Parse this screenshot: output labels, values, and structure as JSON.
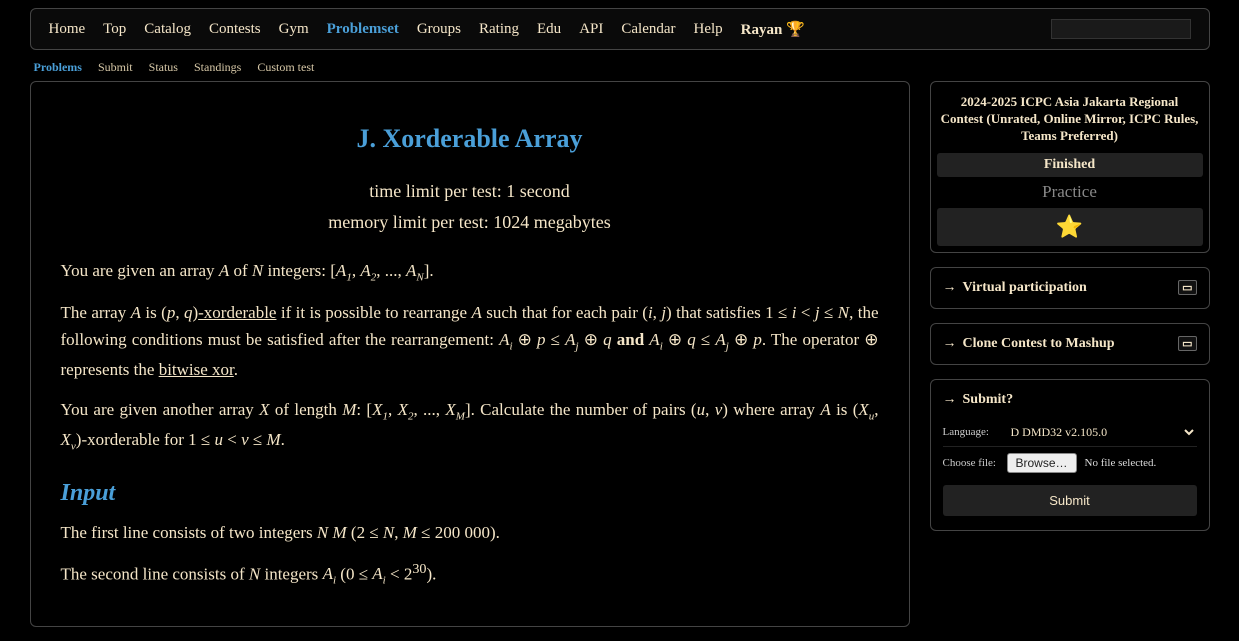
{
  "nav": {
    "items": [
      {
        "label": "Home",
        "active": false
      },
      {
        "label": "Top",
        "active": false
      },
      {
        "label": "Catalog",
        "active": false
      },
      {
        "label": "Contests",
        "active": false
      },
      {
        "label": "Gym",
        "active": false
      },
      {
        "label": "Problemset",
        "active": true
      },
      {
        "label": "Groups",
        "active": false
      },
      {
        "label": "Rating",
        "active": false
      },
      {
        "label": "Edu",
        "active": false
      },
      {
        "label": "API",
        "active": false
      },
      {
        "label": "Calendar",
        "active": false
      },
      {
        "label": "Help",
        "active": false
      }
    ],
    "special": "Rayan 🏆",
    "search_placeholder": ""
  },
  "subnav": {
    "items": [
      {
        "label": "Problems",
        "active": true
      },
      {
        "label": "Submit",
        "active": false
      },
      {
        "label": "Status",
        "active": false
      },
      {
        "label": "Standings",
        "active": false
      },
      {
        "label": "Custom test",
        "active": false
      }
    ]
  },
  "problem": {
    "title": "J. Xorderable Array",
    "time_limit": "time limit per test: 1 second",
    "memory_limit": "memory limit per test: 1024 megabytes",
    "p1_a": "You are given an array ",
    "p1_b": " of ",
    "p1_c": " integers: [",
    "p1_d": ", ",
    "p1_e": ", ..., ",
    "p1_f": "].",
    "p2_a": "The array ",
    "p2_b": " is ",
    "p2_c": "-xorderable",
    "p2_d": " if it is possible to rearrange ",
    "p2_e": " such that for each pair ",
    "p2_f": " that satisfies ",
    "p2_g": ", the following conditions must be satisfied after the rearrangement: ",
    "p2_h": " and ",
    "p2_i": ". The operator  ⊕  represents the ",
    "p2_j": "bitwise xor",
    "p2_k": ".",
    "p3_a": "You are given another array ",
    "p3_b": " of length ",
    "p3_c": ": [",
    "p3_d": ", ",
    "p3_e": ", ..., ",
    "p3_f": "]. Calculate the number of pairs ",
    "p3_g": " where array ",
    "p3_h": " is ",
    "p3_i": "-xorderable for ",
    "p3_j": ".",
    "input_heading": "Input",
    "p4_a": "The first line consists of two integers ",
    "p4_b": " (",
    "p4_c": ").",
    "p5_a": "The second line consists of ",
    "p5_b": " integers ",
    "p5_c": " (",
    "p5_d": ")."
  },
  "sidebar": {
    "contest_name": "2024-2025 ICPC Asia Jakarta Regional Contest (Unrated, Online Mirror, ICPC Rules, Teams Preferred)",
    "status": "Finished",
    "mode": "Practice",
    "virtual": "Virtual participation",
    "clone": "Clone Contest to Mashup",
    "submit_q": "Submit?",
    "lang_label": "Language:",
    "lang_value": "D DMD32 v2.105.0",
    "file_label": "Choose file:",
    "browse": "Browse…",
    "file_status": "No file selected.",
    "submit_btn": "Submit"
  }
}
